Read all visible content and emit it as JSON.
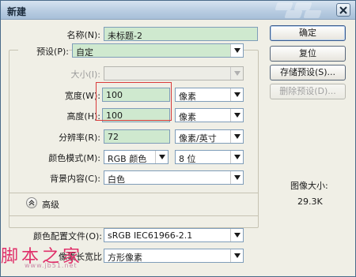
{
  "window": {
    "title": "新建"
  },
  "buttons": {
    "ok": "确定",
    "reset": "复位",
    "save_preset": "存储预设(S)...",
    "delete_preset": "删除预设(D)..."
  },
  "form": {
    "name_label": "名称(N):",
    "name_value": "未标题-2",
    "preset_label": "预设(P):",
    "preset_value": "自定",
    "size_label": "大小(I):",
    "size_value": "",
    "width_label": "宽度(W):",
    "width_value": "100",
    "width_unit": "像素",
    "height_label": "高度(H):",
    "height_value": "100",
    "height_unit": "像素",
    "resolution_label": "分辨率(R):",
    "resolution_value": "72",
    "resolution_unit": "像素/英寸",
    "color_mode_label": "颜色模式(M):",
    "color_mode_value": "RGB 颜色",
    "bit_depth_value": "8 位",
    "background_label": "背景内容(C):",
    "background_value": "白色",
    "advanced_label": "高级",
    "color_profile_label": "颜色配置文件(O):",
    "color_profile_value": "sRGB IEC61966-2.1",
    "pixel_aspect_label": "像素长宽比",
    "pixel_aspect_value": "方形像素"
  },
  "info": {
    "image_size_label": "图像大小:",
    "image_size_value": "29.3K"
  },
  "watermark": {
    "text": "脚本之家",
    "url": "www.jb51.net"
  },
  "icons": {
    "close": "close-icon",
    "dropdown": "chevron-down-icon",
    "expander": "chevron-up-icon"
  }
}
